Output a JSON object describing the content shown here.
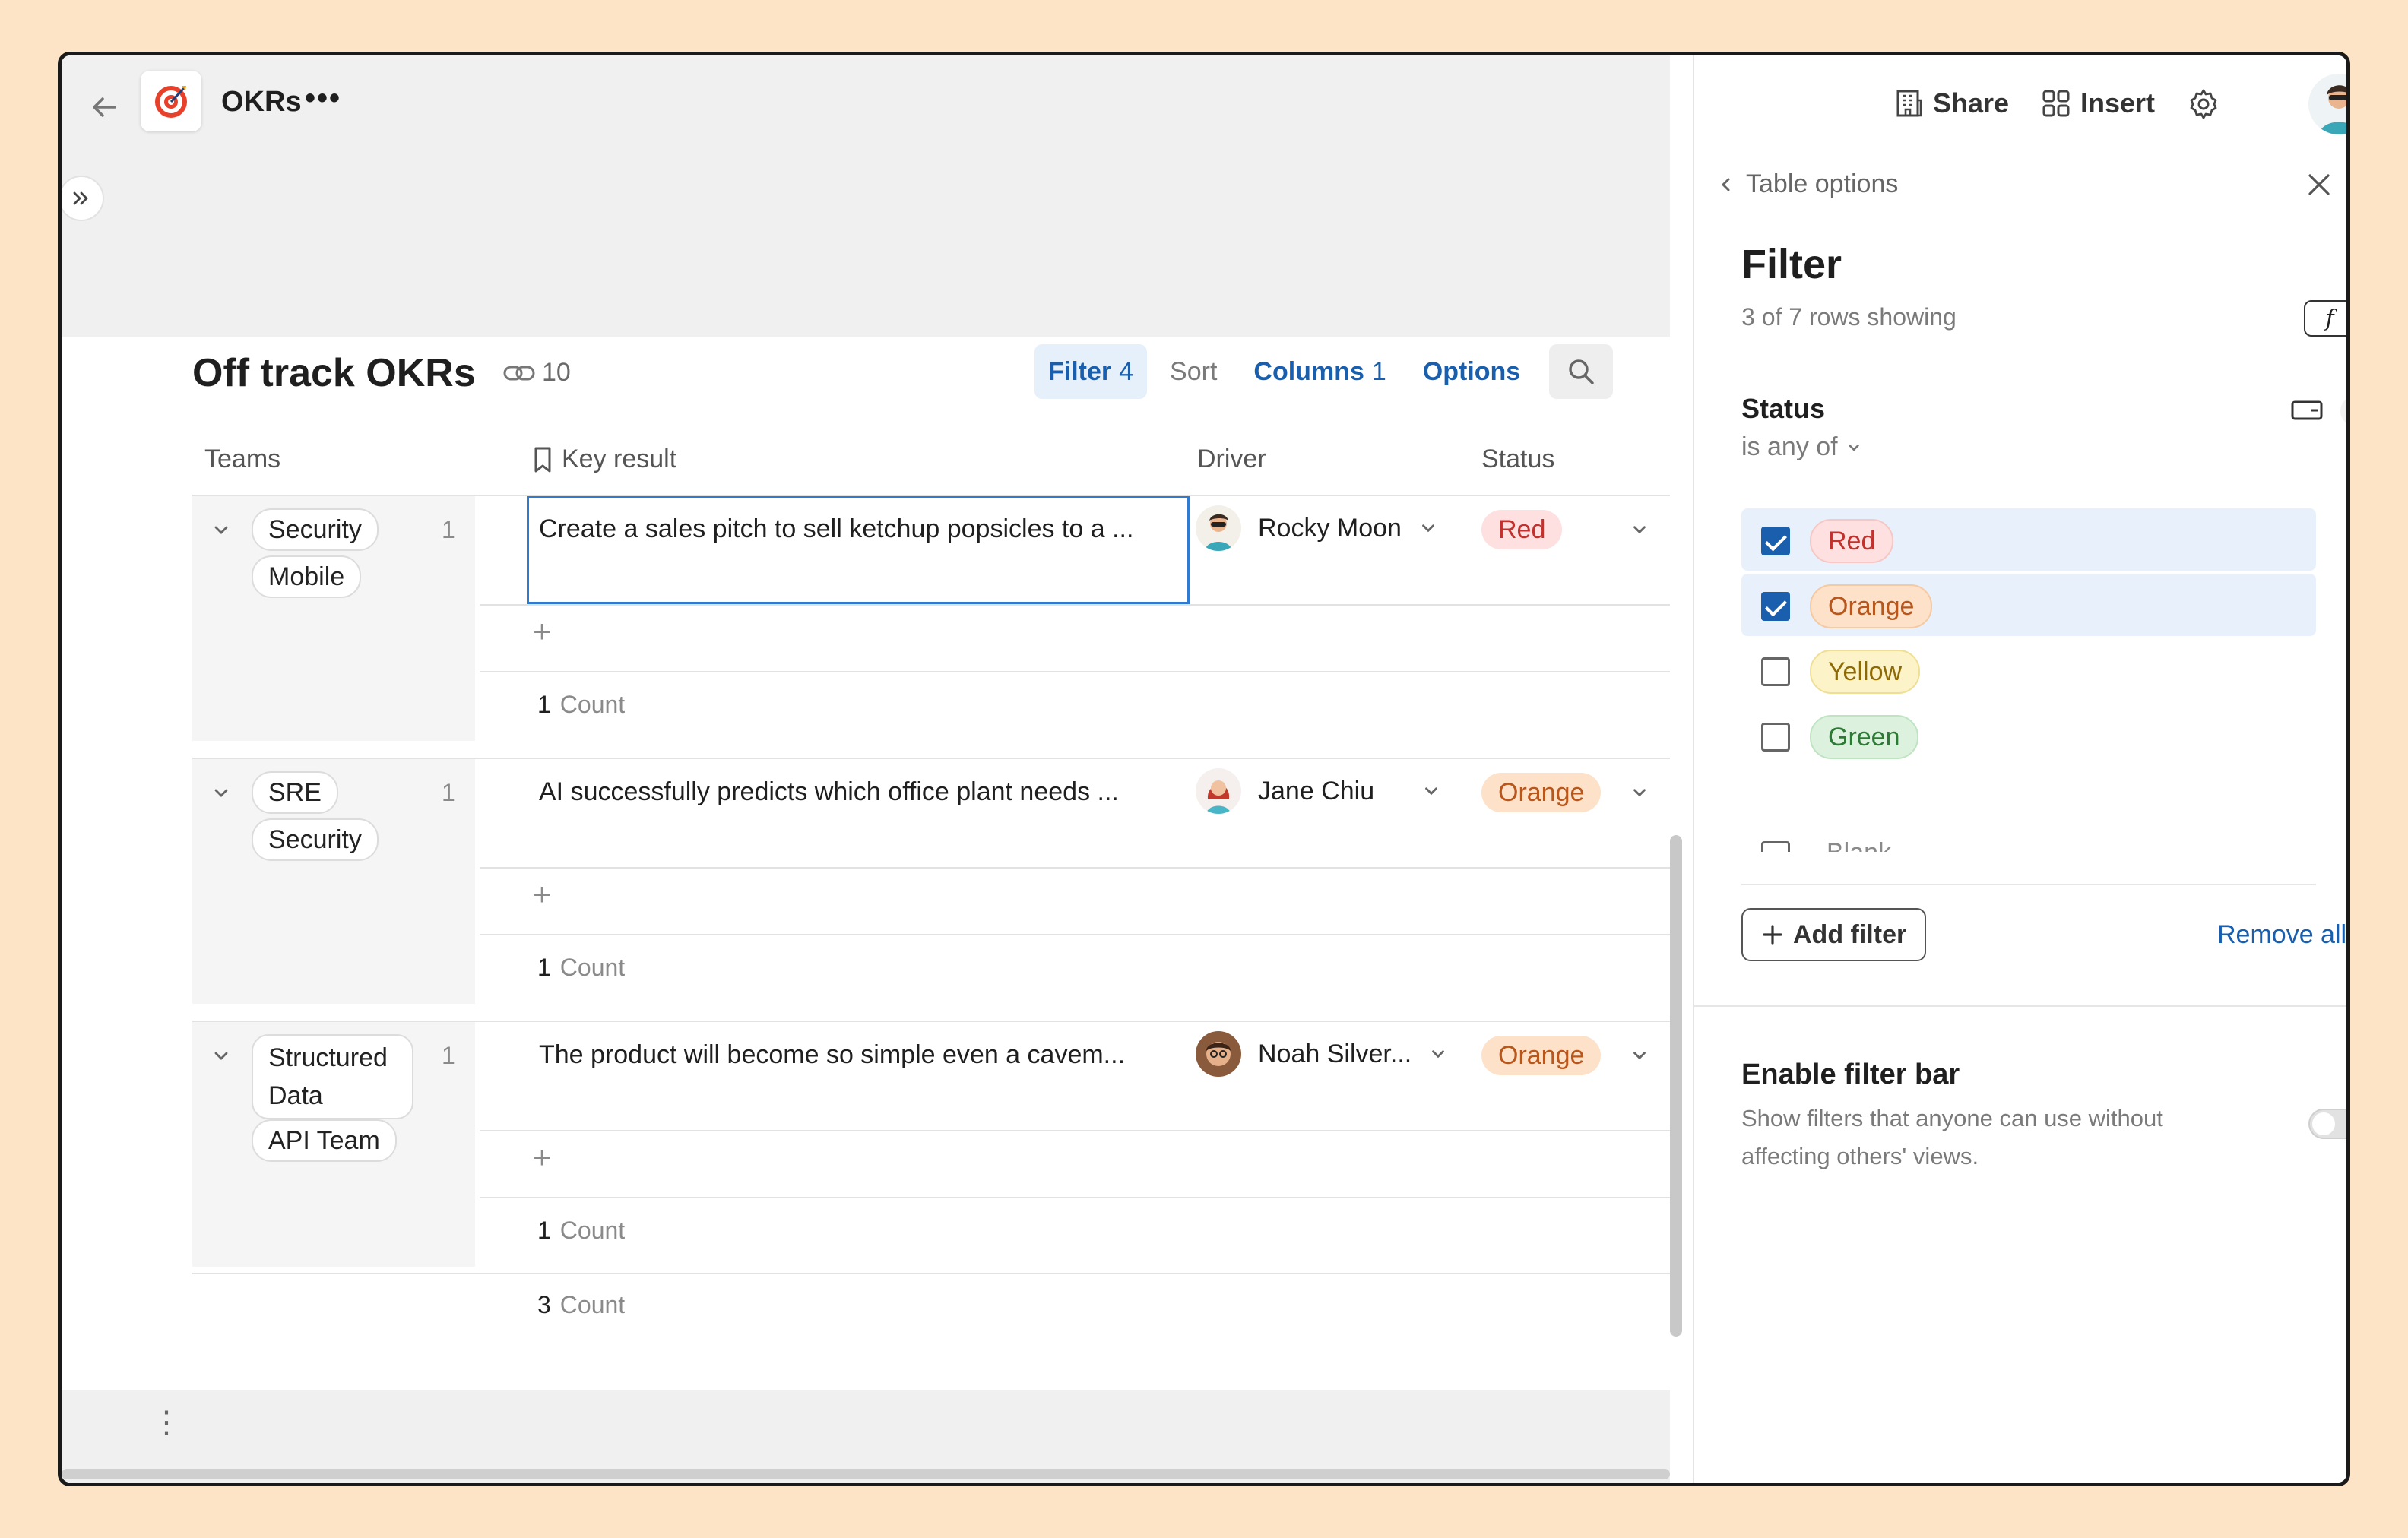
{
  "colors": {
    "background": "#fde4c6",
    "accent": "#1a5fae"
  },
  "doc": {
    "title": "OKRs",
    "more": "•••",
    "icon": "target-icon"
  },
  "table": {
    "title": "Off track OKRs",
    "link_count": "10",
    "toolbar": {
      "filter_label": "Filter",
      "filter_count": "4",
      "sort_label": "Sort",
      "columns_label": "Columns",
      "columns_count": "1",
      "options_label": "Options"
    },
    "columns": [
      "Teams",
      "Key result",
      "Driver",
      "Status"
    ],
    "groups": [
      {
        "teams": [
          "Security",
          "Mobile"
        ],
        "count": "1",
        "key_result": "Create a sales pitch to sell ketchup popsicles to a ...",
        "driver": "Rocky Moon",
        "status": "Red",
        "summary_n": "1",
        "summary_label": "Count"
      },
      {
        "teams": [
          "SRE",
          "Security"
        ],
        "count": "1",
        "key_result": "AI successfully predicts which office plant needs ...",
        "driver": "Jane Chiu",
        "status": "Orange",
        "summary_n": "1",
        "summary_label": "Count"
      },
      {
        "teams": [
          "Structured",
          "Data",
          "API Team"
        ],
        "count": "1",
        "key_result": "The product will become so simple even a cavem...",
        "driver": "Noah Silver...",
        "status": "Orange",
        "summary_n": "1",
        "summary_label": "Count"
      }
    ],
    "total_n": "3",
    "total_label": "Count",
    "add_row": "+"
  },
  "panel": {
    "share_label": "Share",
    "insert_label": "Insert",
    "back_label": "Table options",
    "filter_title": "Filter",
    "rows_showing": "3 of 7 rows showing",
    "fx_label": "f",
    "status_label": "Status",
    "status_condition": "is any of",
    "options": [
      {
        "label": "Red",
        "checked": true
      },
      {
        "label": "Orange",
        "checked": true
      },
      {
        "label": "Yellow",
        "checked": false
      },
      {
        "label": "Green",
        "checked": false
      },
      {
        "label": "Blank",
        "checked": false
      }
    ],
    "add_filter_label": "Add filter",
    "remove_all_label": "Remove all",
    "filter_bar_title": "Enable filter bar",
    "filter_bar_desc": "Show filters that anyone can use without affecting others' views.",
    "filter_bar_enabled": false
  }
}
